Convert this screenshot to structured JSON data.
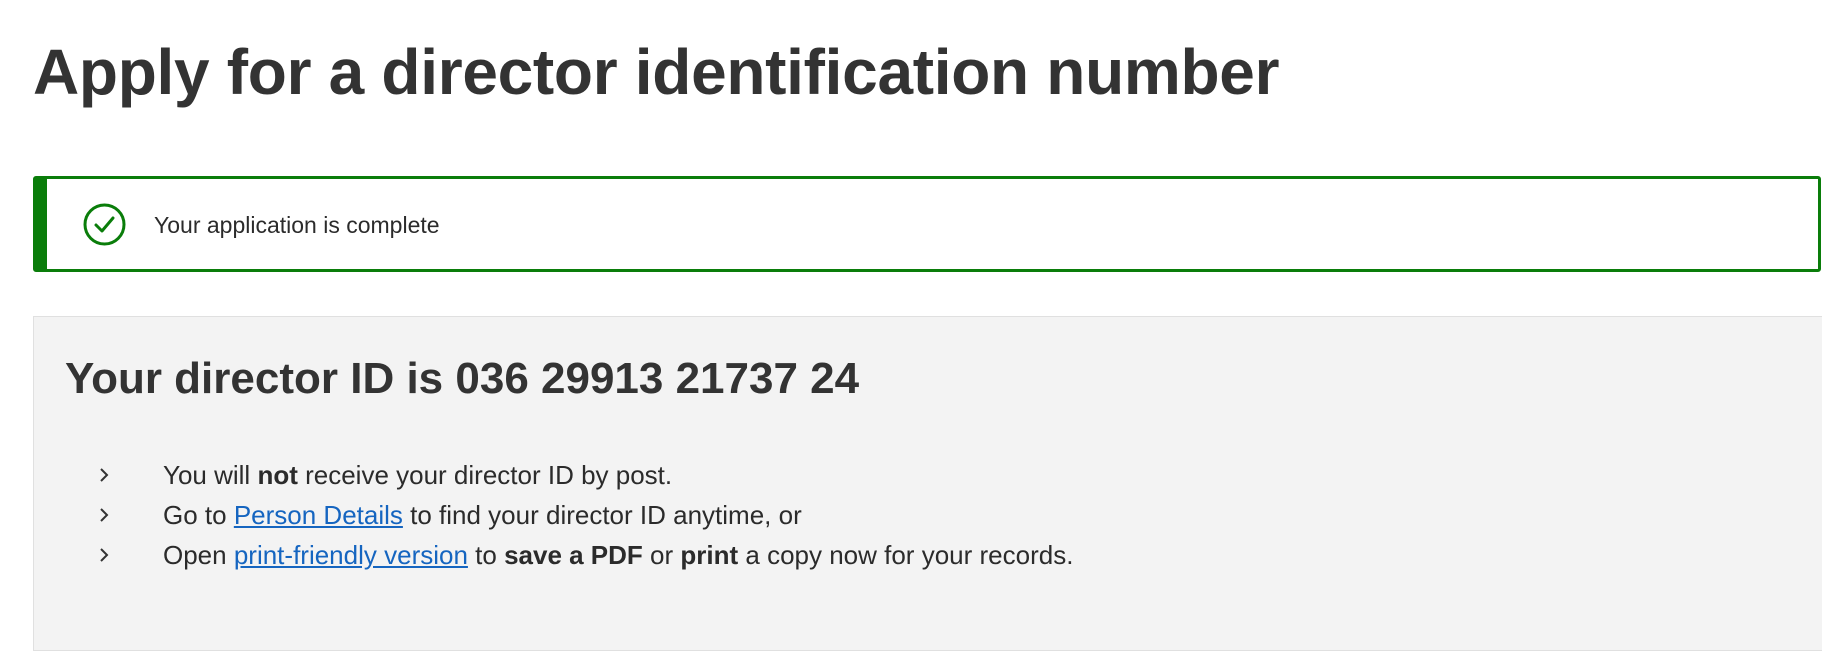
{
  "page": {
    "title": "Apply for a director identification number"
  },
  "success_alert": {
    "icon": "check-circle-icon",
    "message": "Your application is complete",
    "color": "#0a7d0a"
  },
  "director_panel": {
    "heading": "Your director ID is 036 29913 21737 24",
    "items": [
      {
        "icon": "chevron-right-icon",
        "before": "You will ",
        "bold": "not",
        "after": " receive your director ID by post."
      },
      {
        "icon": "chevron-right-icon",
        "before": "Go to ",
        "link": "Person Details",
        "after": " to find your director ID anytime, or"
      },
      {
        "icon": "chevron-right-icon",
        "before": "Open ",
        "link": "print-friendly version",
        "middle": " to ",
        "bold_save": "save a PDF",
        "or": " or ",
        "bold_print": "print",
        "after": " a copy now for your records."
      }
    ]
  },
  "colors": {
    "link": "#1565c0",
    "panel_background": "#f3f3f3",
    "text": "#2b2b2b"
  }
}
